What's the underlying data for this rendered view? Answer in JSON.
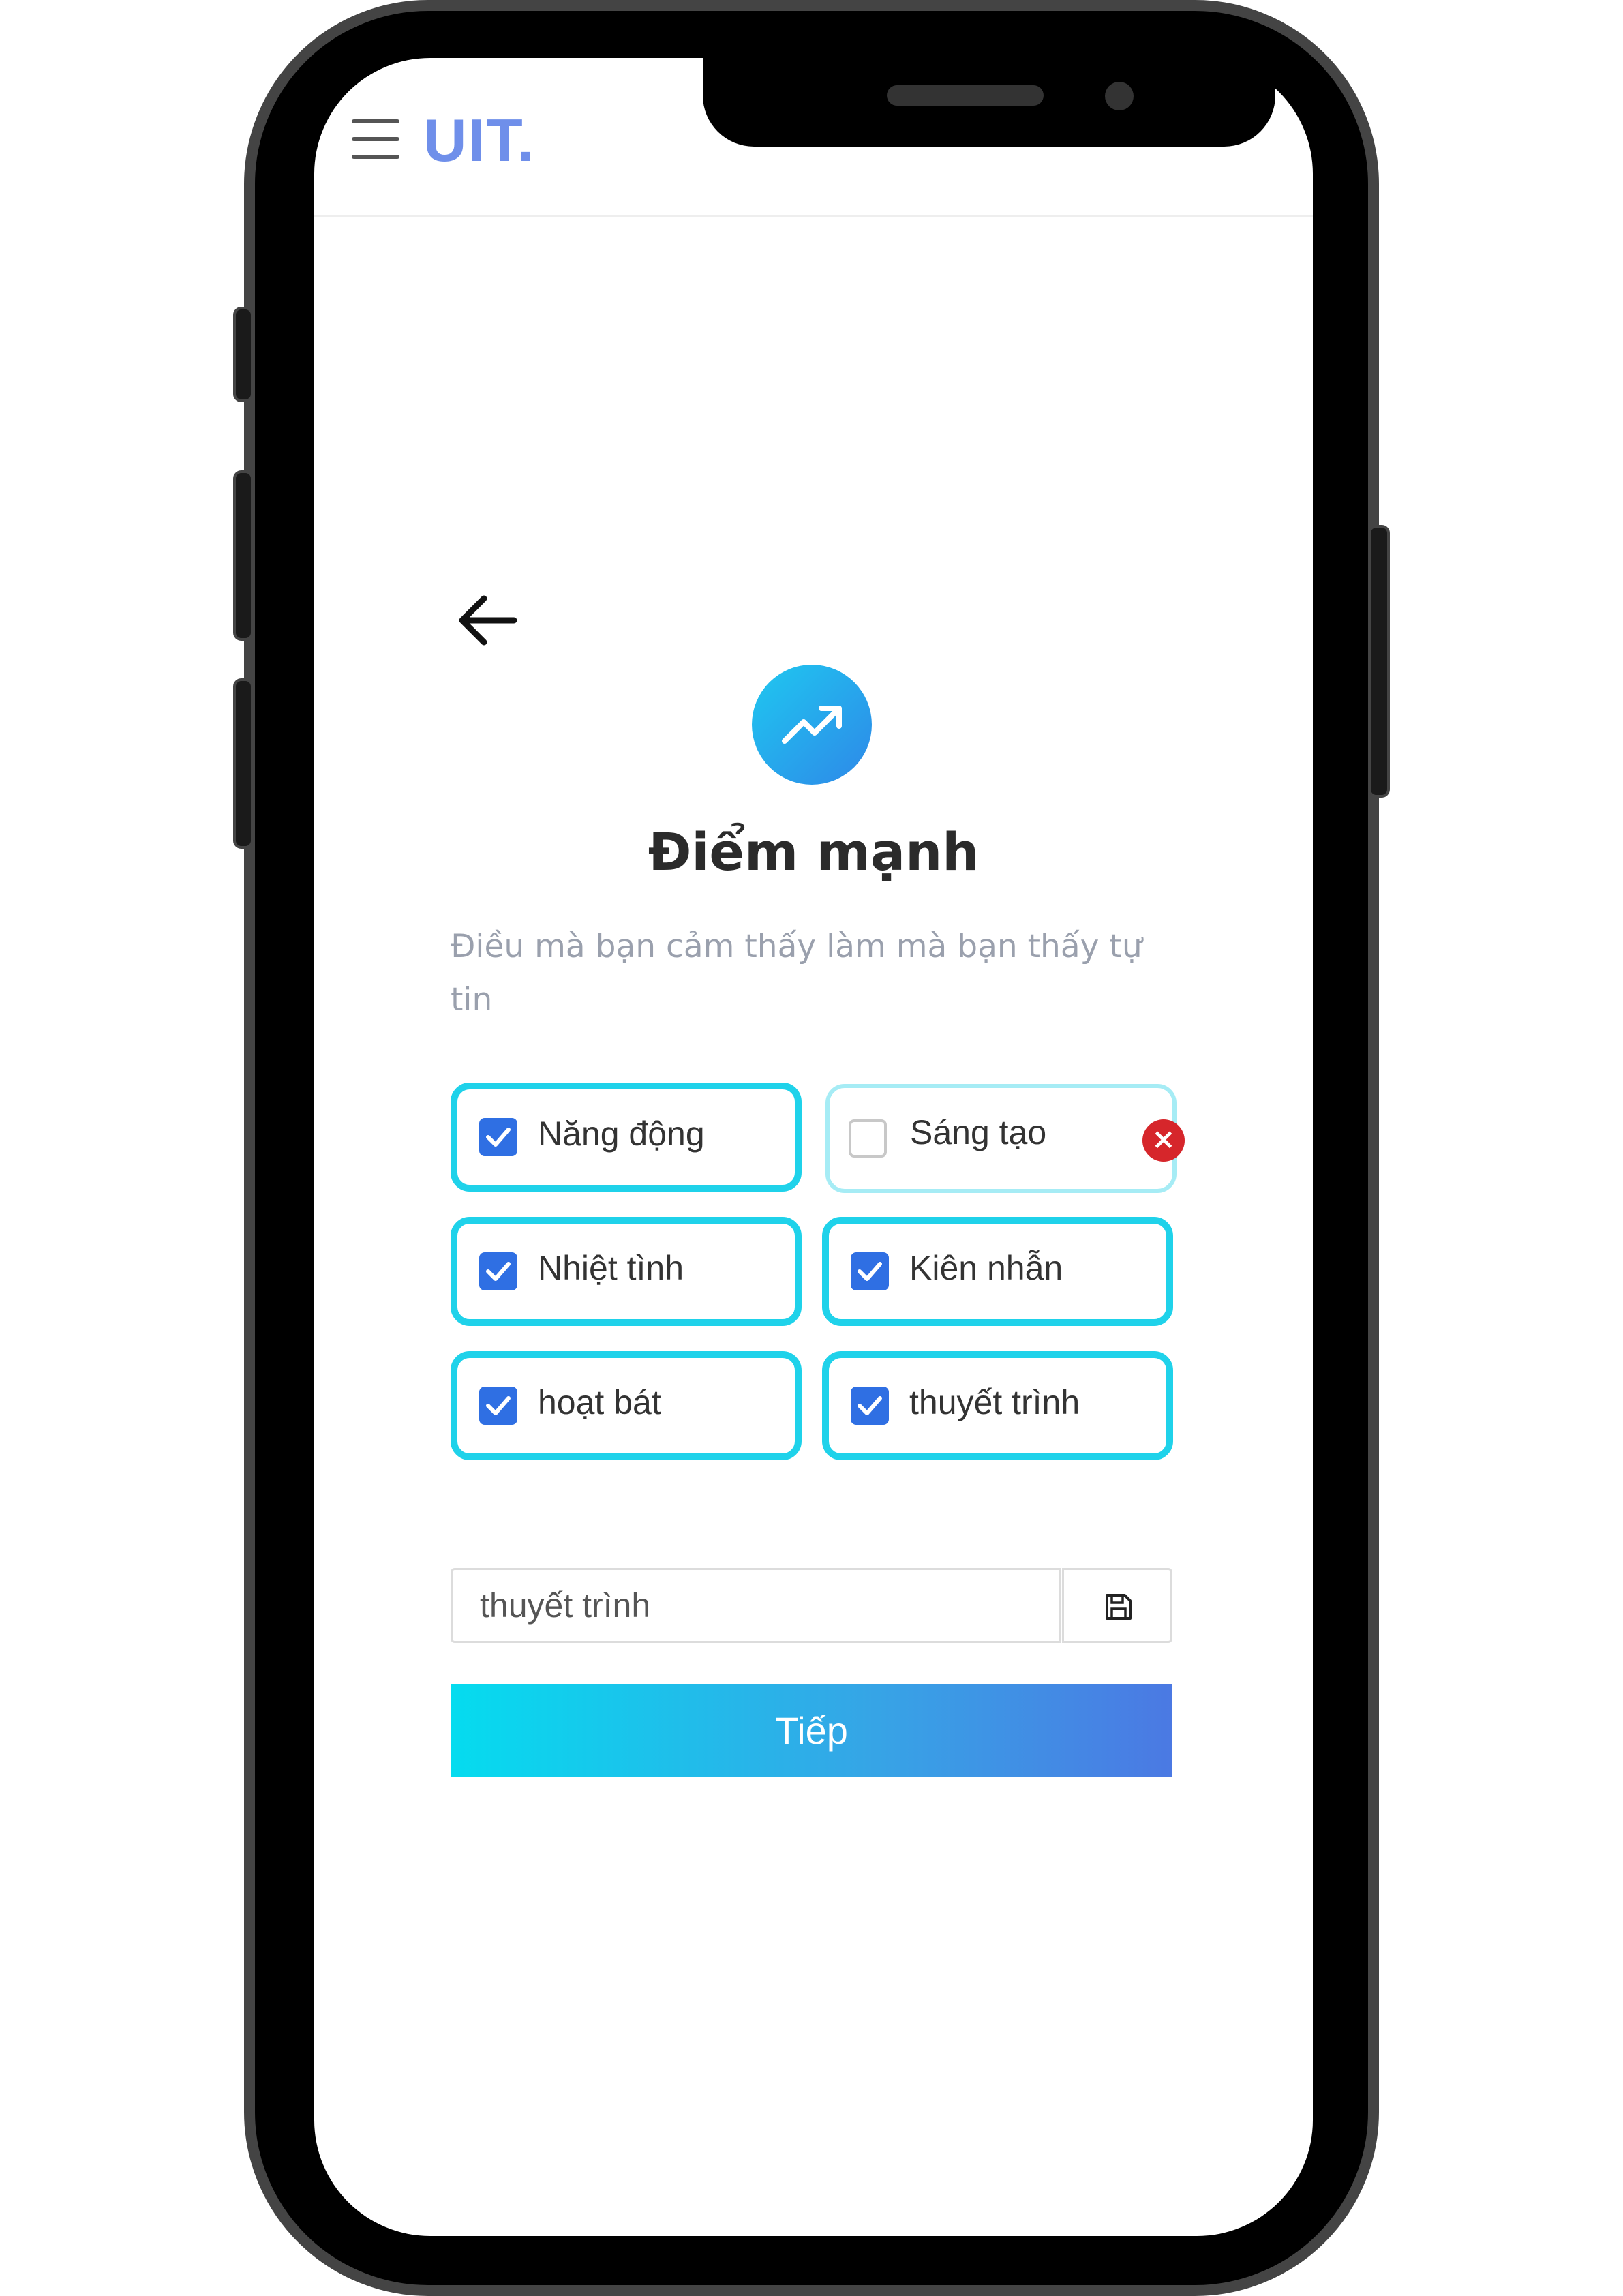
{
  "header": {
    "brand": "UIT."
  },
  "page": {
    "title": "Điểm mạnh",
    "description": "Điều mà bạn cảm thấy làm mà bạn thấy tự tin"
  },
  "options": [
    {
      "label": "Năng động",
      "checked": true
    },
    {
      "label": "Sáng tạo",
      "checked": false
    },
    {
      "label": "Nhiệt tình",
      "checked": true
    },
    {
      "label": "Kiên nhẫn",
      "checked": true
    },
    {
      "label": "hoạt bát",
      "checked": true
    },
    {
      "label": "thuyết trình",
      "checked": true
    }
  ],
  "new_item": {
    "value": "thuyết trình"
  },
  "next_button": {
    "label": "Tiếp"
  },
  "remove_badge": {
    "label": "×"
  },
  "colors": {
    "accent_border": "#1fd2ea",
    "checkbox_checked": "#2f6fe3",
    "brand": "#6f8fea",
    "remove_badge": "#d6262b"
  },
  "icons": {
    "menu": "hamburger-icon",
    "back": "arrow-left-icon",
    "feature": "trending-up-icon",
    "save": "floppy-disk-icon",
    "remove": "close-icon"
  }
}
